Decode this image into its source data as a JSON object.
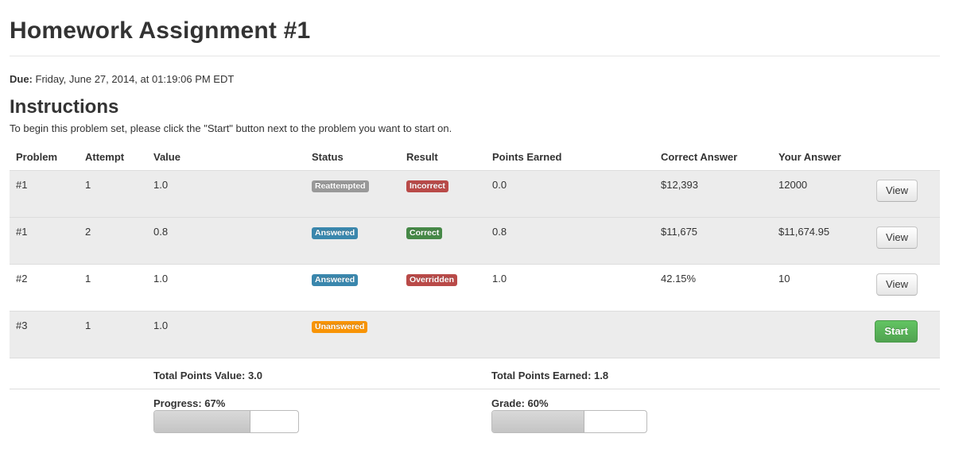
{
  "page_title": "Homework Assignment #1",
  "due": {
    "label": "Due:",
    "value": "Friday, June 27, 2014, at 01:19:06 PM EDT"
  },
  "instructions": {
    "title": "Instructions",
    "text": "To begin this problem set, please click the \"Start\" button next to the problem you want to start on."
  },
  "table": {
    "headers": [
      "Problem",
      "Attempt",
      "Value",
      "Status",
      "Result",
      "Points Earned",
      "Correct Answer",
      "Your Answer",
      ""
    ],
    "rows": [
      {
        "problem": "#1",
        "attempt": "1",
        "value": "1.0",
        "status": "Reattempted",
        "result": "Incorrect",
        "points": "0.0",
        "correct": "$12,393",
        "yours": "12000",
        "action": "View"
      },
      {
        "problem": "#1",
        "attempt": "2",
        "value": "0.8",
        "status": "Answered",
        "result": "Correct",
        "points": "0.8",
        "correct": "$11,675",
        "yours": "$11,674.95",
        "action": "View"
      },
      {
        "problem": "#2",
        "attempt": "1",
        "value": "1.0",
        "status": "Answered",
        "result": "Overridden",
        "points": "1.0",
        "correct": "42.15%",
        "yours": "10",
        "action": "View"
      },
      {
        "problem": "#3",
        "attempt": "1",
        "value": "1.0",
        "status": "Unanswered",
        "result": "",
        "points": "",
        "correct": "",
        "yours": "",
        "action": "Start"
      }
    ]
  },
  "summary": {
    "total_value": "Total Points Value: 3.0",
    "total_earned": "Total Points Earned: 1.8"
  },
  "progress": {
    "label": "Progress: 67%",
    "fraction": 0.67
  },
  "grade": {
    "label": "Grade: 60%",
    "fraction": 0.6
  },
  "colors": {
    "status_reattempted": "#999999",
    "status_answered": "#3a87ad",
    "status_unanswered": "#f89406",
    "result_incorrect": "#b94a48",
    "result_correct": "#468847",
    "result_overridden": "#b94a48",
    "button_start": "#5bb75b"
  }
}
